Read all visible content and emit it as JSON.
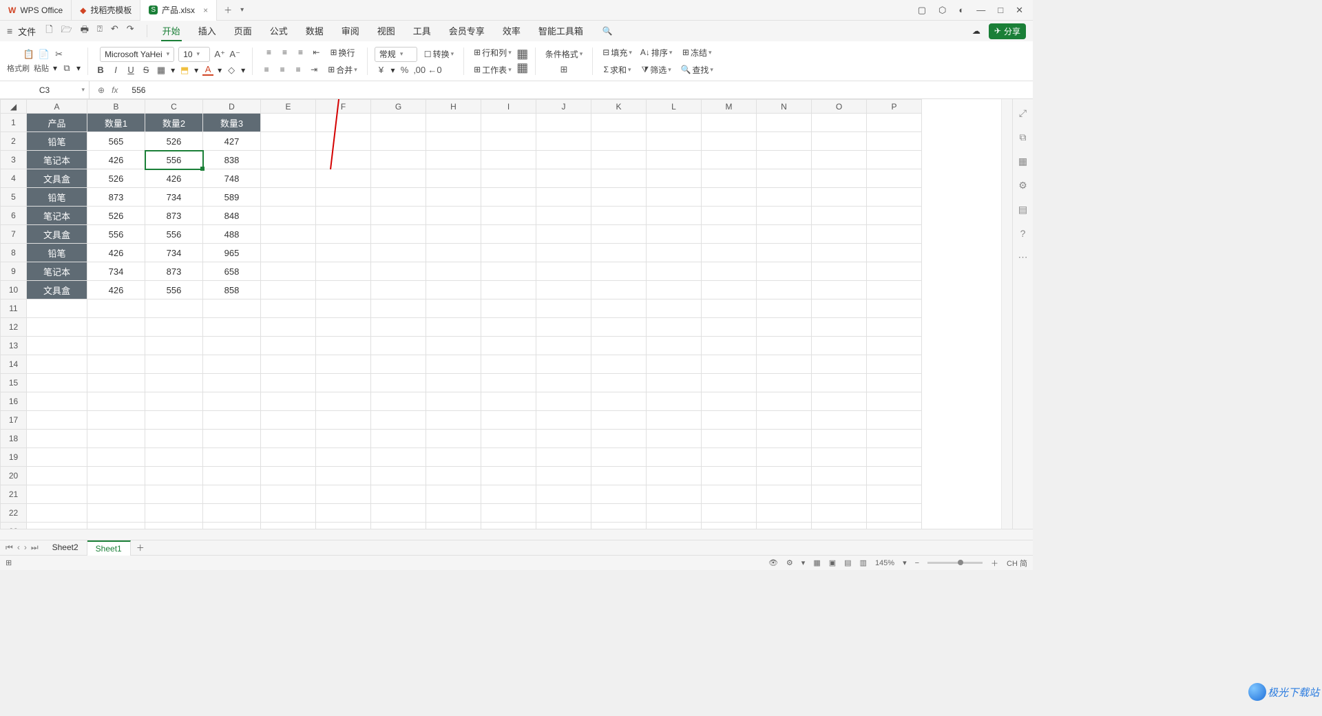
{
  "tabs": {
    "app": "WPS Office",
    "template": "找稻壳模板",
    "file": "产品.xlsx",
    "close": "×",
    "plus": "＋"
  },
  "win": {
    "panel": "▢",
    "cube": "⬡",
    "user": "◐",
    "min": "—",
    "max": "□",
    "close": "✕"
  },
  "menubar": {
    "hamburger": "≡",
    "file": "文件",
    "qat": {
      "new": "🗋",
      "open": "🗁",
      "print": "🖶",
      "preview": "⍰",
      "undo": "↶",
      "redo": "↷"
    },
    "tabs": [
      "开始",
      "插入",
      "页面",
      "公式",
      "数据",
      "审阅",
      "视图",
      "工具",
      "会员专享",
      "效率",
      "智能工具箱"
    ],
    "active_index": 0,
    "search": "🔍",
    "cloud": "☁",
    "share": "分享"
  },
  "ribbon": {
    "clipboard": {
      "paste": "📋",
      "paste_label": "格式刷",
      "copy": "📄",
      "cut": "✂",
      "paste2": "粘贴",
      "opts": "⧉"
    },
    "font": {
      "name": "Microsoft YaHei",
      "size": "10",
      "inc": "A⁺",
      "dec": "A⁻",
      "bold": "B",
      "italic": "I",
      "underline": "U",
      "strike": "S",
      "border": "▦",
      "fill": "⬒",
      "color": "A",
      "clear": "◇"
    },
    "align": {
      "t": "≡",
      "m": "≡",
      "b": "≡",
      "wrap": "换行",
      "l": "≡",
      "c": "≡",
      "r": "≡",
      "j": "≡",
      "indent_dec": "⇤",
      "indent_inc": "⇥",
      "merge": "合并"
    },
    "number": {
      "format": "常规",
      "convert": "转换",
      "currency": "¥",
      "percent": "%",
      "comma": "‚00",
      "inc_dec": "←0",
      ".dec": ".00"
    },
    "cells": {
      "rowcol": "行和列",
      "worksheet": "工作表",
      "table": "▦",
      "table2": "▦"
    },
    "editing": {
      "cond": "条件格式",
      "border": "⊞",
      "fill": "填充",
      "sort": "排序",
      "freeze": "冻结",
      "sum": "求和",
      "filter": "筛选",
      "find": "查找"
    }
  },
  "fx": {
    "cell": "C3",
    "zoom": "⊕",
    "fx": "fx",
    "value": "556"
  },
  "columns": [
    "A",
    "B",
    "C",
    "D",
    "E",
    "F",
    "G",
    "H",
    "I",
    "J",
    "K",
    "L",
    "M",
    "N",
    "O",
    "P"
  ],
  "row_count": 23,
  "selected": {
    "row": 3,
    "col": "C"
  },
  "header_row": [
    "产品",
    "数量1",
    "数量2",
    "数量3"
  ],
  "data_rows": [
    [
      "铅笔",
      "565",
      "526",
      "427"
    ],
    [
      "笔记本",
      "426",
      "556",
      "838"
    ],
    [
      "文具盒",
      "526",
      "426",
      "748"
    ],
    [
      "铅笔",
      "873",
      "734",
      "589"
    ],
    [
      "笔记本",
      "526",
      "873",
      "848"
    ],
    [
      "文具盒",
      "556",
      "556",
      "488"
    ],
    [
      "铅笔",
      "426",
      "734",
      "965"
    ],
    [
      "笔记本",
      "734",
      "873",
      "658"
    ],
    [
      "文具盒",
      "426",
      "556",
      "858"
    ]
  ],
  "sheets": {
    "nav": [
      "⏮",
      "‹",
      "›",
      "⏭"
    ],
    "tabs": [
      "Sheet2",
      "Sheet1"
    ],
    "active_index": 1,
    "add": "＋"
  },
  "status": {
    "left": "⊞",
    "eye": "👁",
    "gear": "⚙",
    "views": [
      "▦",
      "▣",
      "▤",
      "▥"
    ],
    "zoom": "145%",
    "minus": "−",
    "plus": "＋",
    "ime": "CH 简",
    "watermark": "极光下载站"
  },
  "sidepanel": [
    "⤢",
    "⧉",
    "▦",
    "⚙",
    "▤",
    "?",
    "⋯"
  ]
}
